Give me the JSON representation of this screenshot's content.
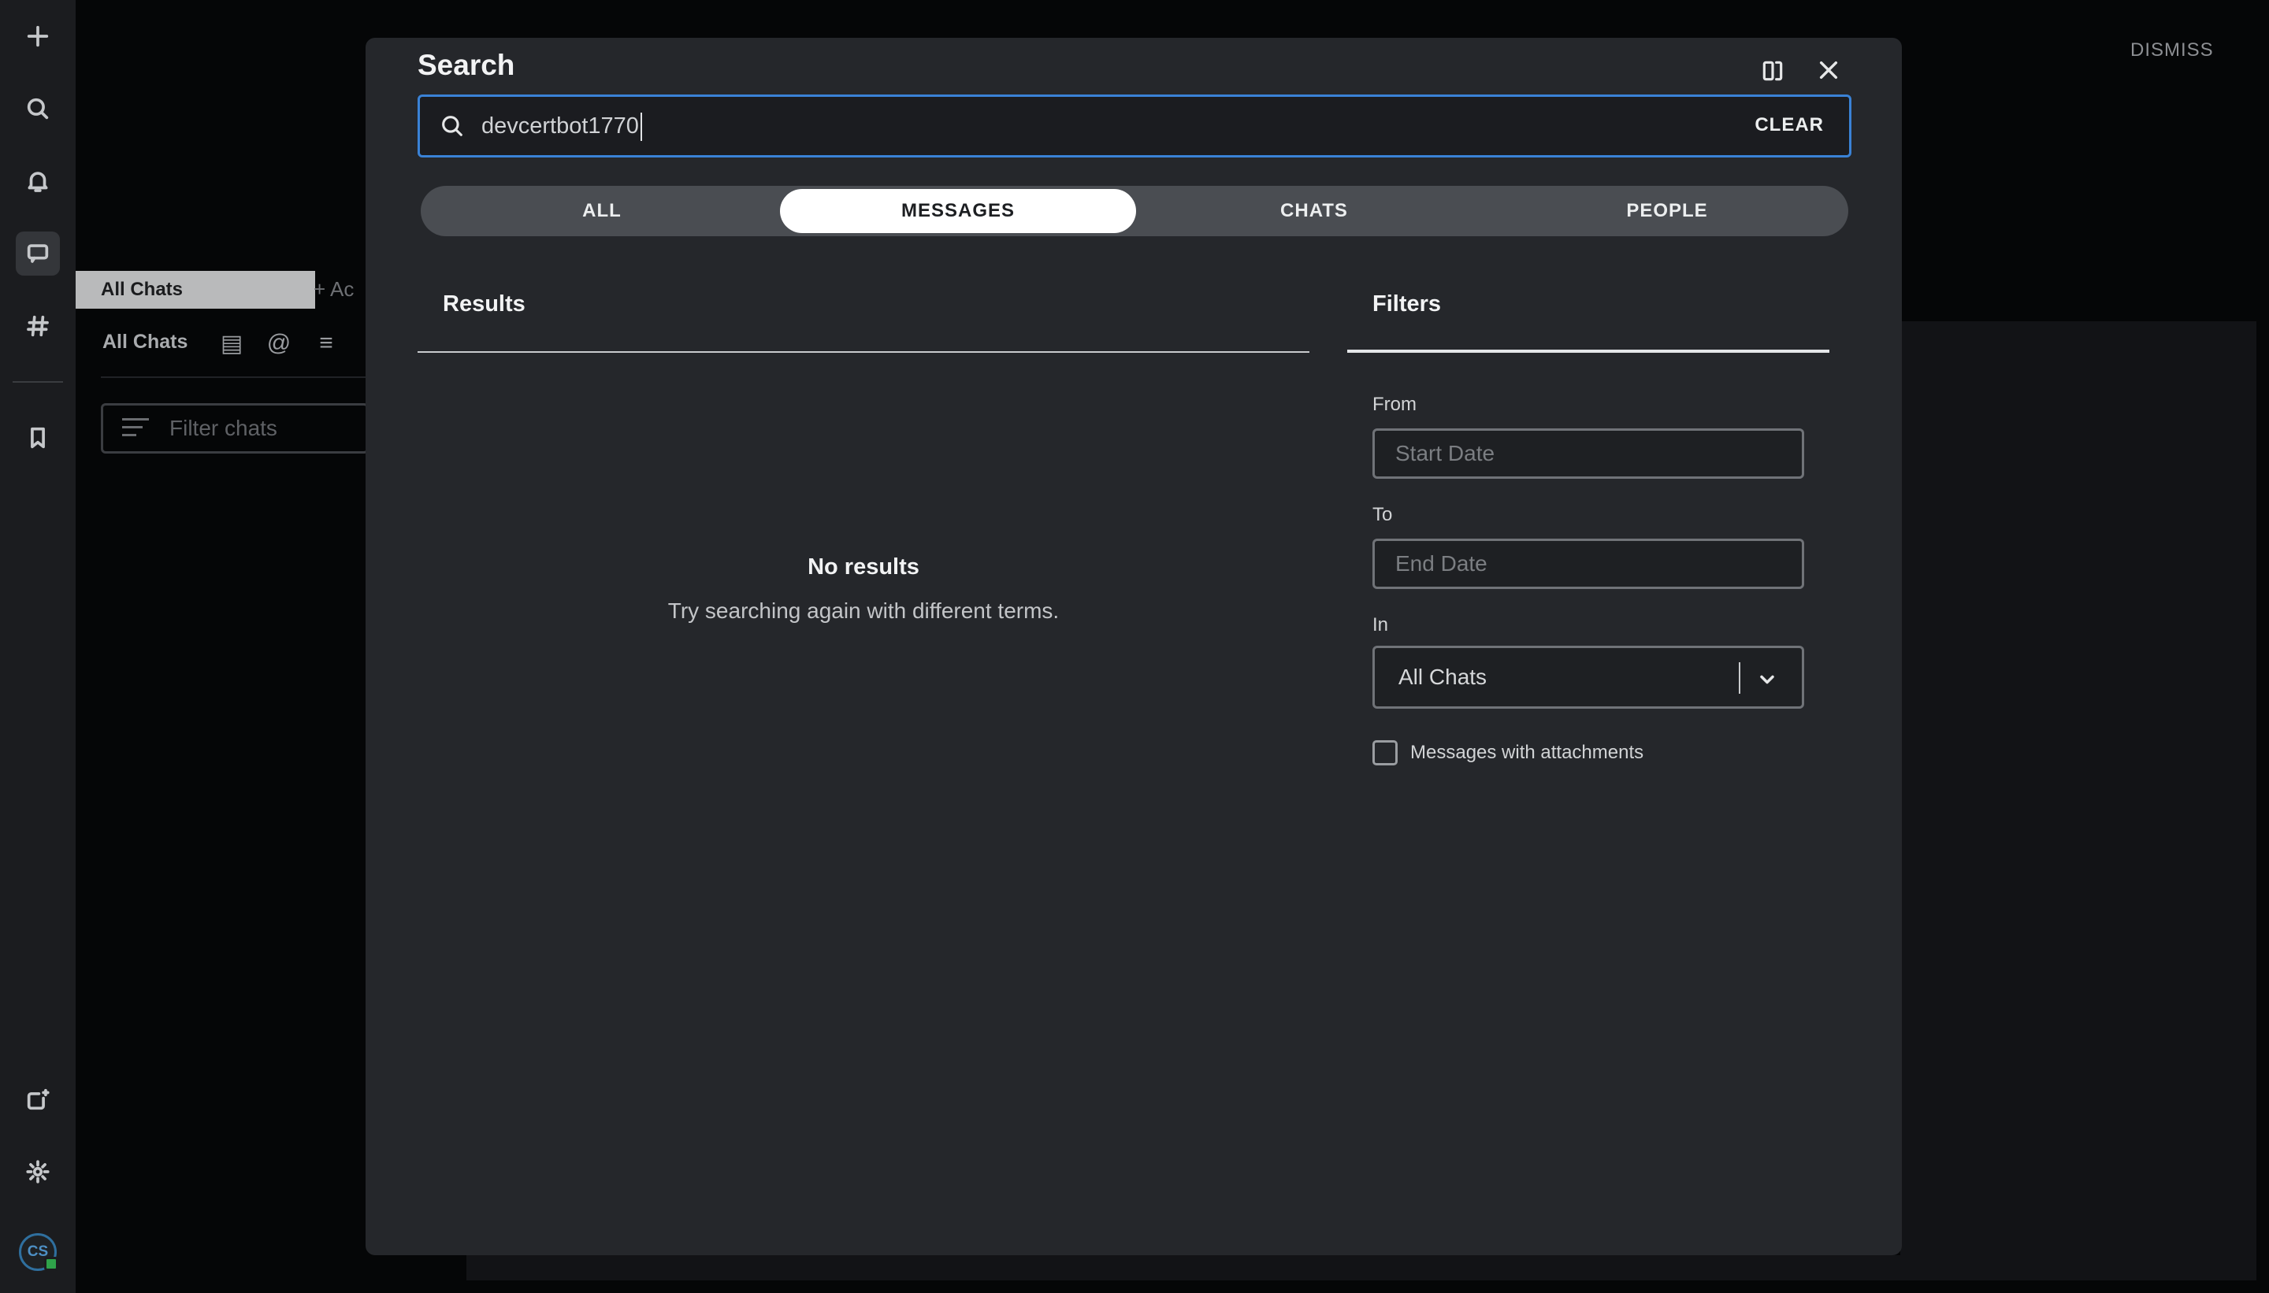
{
  "background": {
    "tab_label": "All Chats",
    "add_label": "Ac",
    "list_title": "All Chats",
    "filter_placeholder": "Filter chats",
    "dismiss_label": "DISMISS"
  },
  "rail": {
    "icons": [
      "plus-icon",
      "search-icon",
      "bell-icon",
      "chat-icon",
      "hashtag-icon",
      "bookmark-icon",
      "new-window-icon",
      "gear-icon"
    ],
    "avatar_initials": "CS",
    "status_color": "#2fa24a"
  },
  "modal": {
    "title": "Search",
    "search": {
      "value": "devcertbot1770",
      "clear_label": "CLEAR"
    },
    "tabs": [
      {
        "label": "ALL",
        "active": false
      },
      {
        "label": "MESSAGES",
        "active": true
      },
      {
        "label": "CHATS",
        "active": false
      },
      {
        "label": "PEOPLE",
        "active": false
      }
    ],
    "results": {
      "heading": "Results",
      "empty_title": "No results",
      "empty_subtitle": "Try searching again with different terms."
    },
    "filters": {
      "heading": "Filters",
      "from_label": "From",
      "from_placeholder": "Start Date",
      "to_label": "To",
      "to_placeholder": "End Date",
      "in_label": "In",
      "in_value": "All Chats",
      "attachments_label": "Messages with attachments",
      "attachments_checked": false
    }
  },
  "colors": {
    "accent": "#3a82d6",
    "modal_bg": "#25272b",
    "rail_bg": "#1b1c1f"
  }
}
